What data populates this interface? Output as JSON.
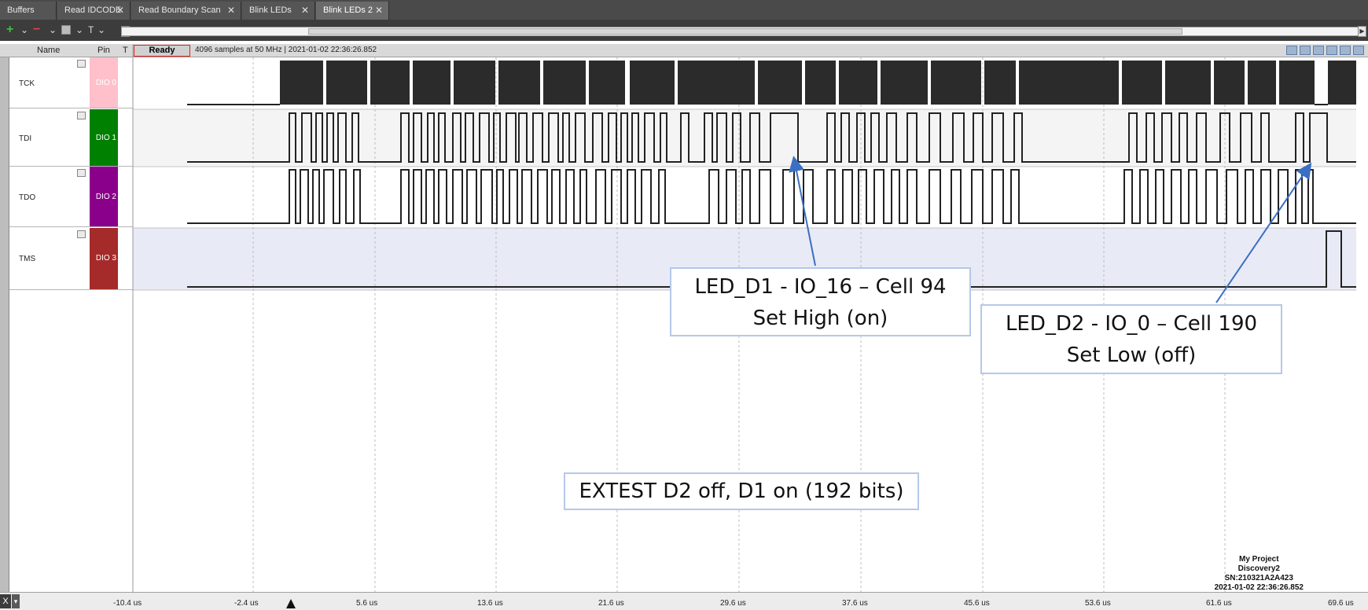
{
  "tabs": [
    {
      "label": "Buffers",
      "closable": false,
      "active": false
    },
    {
      "label": "Read IDCODE",
      "closable": true,
      "active": false
    },
    {
      "label": "Read Boundary Scan",
      "closable": true,
      "active": false
    },
    {
      "label": "Blink LEDs",
      "closable": true,
      "active": false
    },
    {
      "label": "Blink LEDs 2",
      "closable": true,
      "active": true
    }
  ],
  "toolbar": {
    "add_label": "+",
    "remove_label": "−",
    "dropdown_label": "⌄",
    "t_label": "T"
  },
  "header": {
    "name_label": "Name",
    "pin_label": "Pin",
    "t_label": "T",
    "status": "Ready",
    "info": "4096 samples at 50 MHz | 2021-01-02 22:36:26.852"
  },
  "channels": [
    {
      "name": "TCK",
      "pin": "DIO 0",
      "color": "#ffc0cb"
    },
    {
      "name": "TDI",
      "pin": "DIO 1",
      "color": "#008000"
    },
    {
      "name": "TDO",
      "pin": "DIO 2",
      "color": "#8b008b"
    },
    {
      "name": "TMS",
      "pin": "DIO 3",
      "color": "#a52a2a"
    }
  ],
  "time_ticks": [
    "-10.4 us",
    "-2.4 us",
    "5.6 us",
    "13.6 us",
    "21.6 us",
    "29.6 us",
    "37.6 us",
    "45.6 us",
    "53.6 us",
    "61.6 us",
    "69.6 us"
  ],
  "callouts": {
    "d1_line1": "LED_D1 - IO_16 – Cell 94",
    "d1_line2": "Set High (on)",
    "d2_line1": "LED_D2 - IO_0 – Cell 190",
    "d2_line2": "Set Low (off)",
    "extest": "EXTEST D2 off, D1 on (192 bits)"
  },
  "device_info": {
    "project": "My Project",
    "device": "Discovery2",
    "serial": "SN:210321A2A423",
    "timestamp": "2021-01-02 22:36:26.852"
  },
  "bottom": {
    "x_label": "X"
  },
  "colors": {
    "tab_bar": "#4a4a4a",
    "toolbar": "#3c3c3c",
    "trace": "#222222",
    "tms_highlight": "#e8eaf6",
    "callout_border": "#b5c8e8",
    "arrow": "#3a6fc4"
  }
}
